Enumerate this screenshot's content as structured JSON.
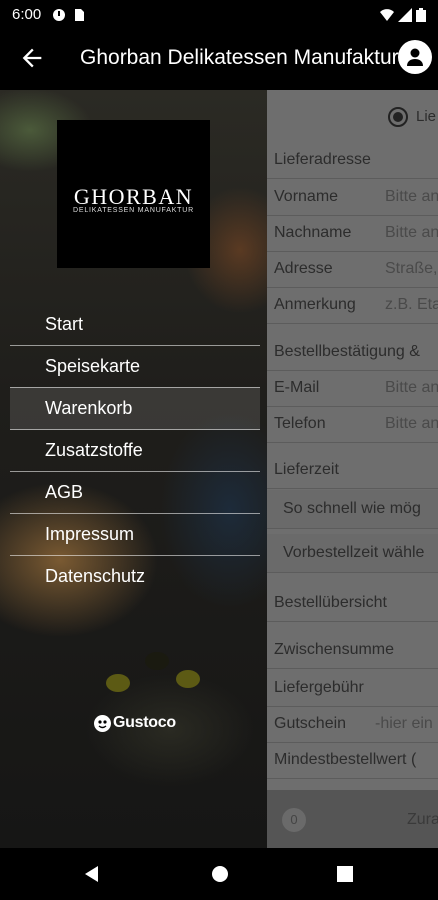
{
  "status": {
    "time": "6:00"
  },
  "appbar": {
    "title": "Ghorban Delikatessen Manufaktur"
  },
  "drawer": {
    "logo": {
      "brand": "GHORBAN",
      "tagline": "DELIKATESSEN MANUFAKTUR"
    },
    "items": [
      {
        "label": "Start"
      },
      {
        "label": "Speisekarte"
      },
      {
        "label": "Warenkorb"
      },
      {
        "label": "Zusatzstoffe"
      },
      {
        "label": "AGB"
      },
      {
        "label": "Impressum"
      },
      {
        "label": "Datenschutz"
      }
    ],
    "footer": "Gustoco"
  },
  "form": {
    "radio_label": "Lie",
    "delivery_address_heading": "Lieferadresse",
    "fields": [
      {
        "label": "Vorname",
        "placeholder": "Bitte an"
      },
      {
        "label": "Nachname",
        "placeholder": "Bitte an"
      },
      {
        "label": "Adresse",
        "placeholder": "Straße,"
      },
      {
        "label": "Anmerkung",
        "placeholder": "z.B. Eta"
      }
    ],
    "confirmation_heading": "Bestellbestätigung &",
    "contact_fields": [
      {
        "label": "E-Mail",
        "placeholder": "Bitte an"
      },
      {
        "label": "Telefon",
        "placeholder": "Bitte an"
      }
    ],
    "delivery_time_heading": "Lieferzeit",
    "delivery_time_options": [
      "So schnell wie mög",
      "Vorbestellzeit wähle"
    ],
    "summary_heading": "Bestellübersicht",
    "summary_rows": [
      {
        "label": "Zwischensumme"
      },
      {
        "label": "Liefergebühr"
      },
      {
        "label": "Gutschein",
        "placeholder": "-hier ein"
      },
      {
        "label": "Mindestbestellwert ("
      }
    ],
    "cart_count": "0",
    "footer_label": "Zura"
  }
}
